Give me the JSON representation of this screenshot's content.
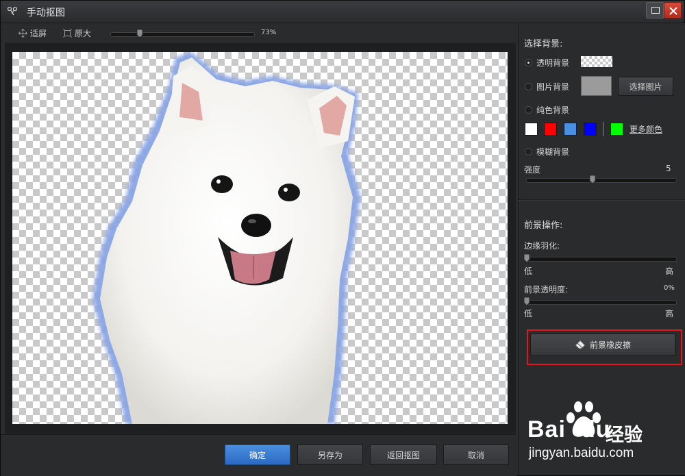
{
  "window": {
    "title": "手动抠图"
  },
  "toolbar": {
    "fit_label": "适屏",
    "original_label": "原大",
    "zoom_value": "73%",
    "zoom_fraction": 0.2
  },
  "bottom": {
    "ok": "确定",
    "save_as": "另存为",
    "back": "返回抠图",
    "cancel": "取消"
  },
  "background": {
    "title": "选择背景:",
    "options": [
      {
        "label": "透明背景",
        "selected": true
      },
      {
        "label": "图片背景",
        "selected": false
      },
      {
        "label": "纯色背景",
        "selected": false
      },
      {
        "label": "模糊背景",
        "selected": false
      }
    ],
    "choose_image": "选择图片",
    "colors": [
      "#ffffff",
      "#ff0000",
      "#4a90e2",
      "#0000ff",
      "#00ff00"
    ],
    "more_colors": "更多颜色",
    "strength_label": "强度",
    "strength_value": "5",
    "strength_fraction": 0.44
  },
  "foreground": {
    "title": "前景操作:",
    "feather_label": "边缘羽化:",
    "feather_fraction": 0.0,
    "opacity_label": "前景透明度:",
    "opacity_value": "0%",
    "opacity_fraction": 0.0,
    "low": "低",
    "high": "高",
    "eraser": "前景橡皮擦"
  },
  "watermark": {
    "brand_left": "Bai",
    "brand_right": "du",
    "product": "经验",
    "url": "jingyan.baidu.com"
  }
}
